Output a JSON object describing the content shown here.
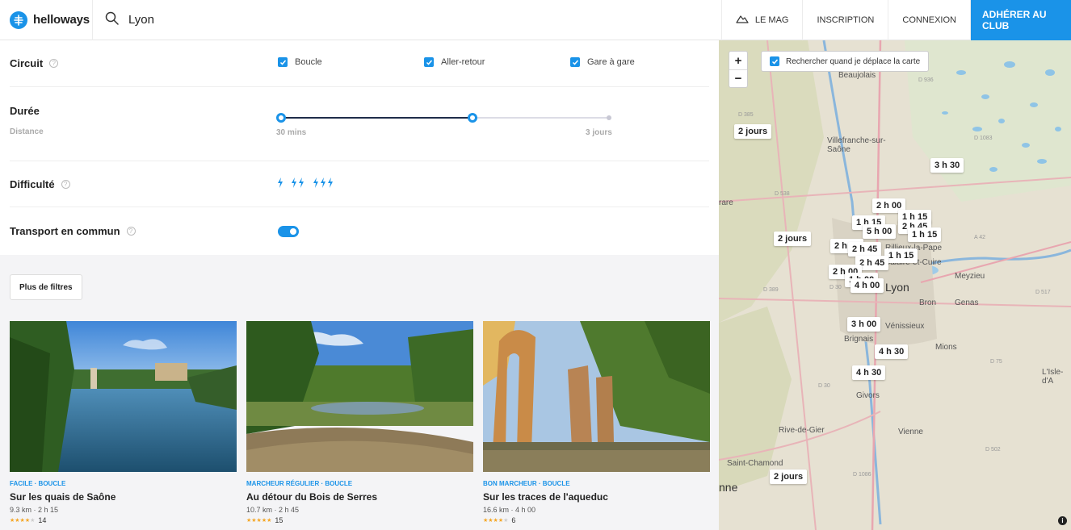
{
  "brand": {
    "name": "helloways",
    "color": "#1a93e8"
  },
  "search": {
    "value": "Lyon",
    "icon": "search-icon"
  },
  "nav": {
    "mag_label": "LE MAG",
    "signup_label": "INSCRIPTION",
    "login_label": "CONNEXION",
    "cta_label": "ADHÉRER AU CLUB"
  },
  "filters": {
    "circuit": {
      "label": "Circuit",
      "options": [
        {
          "label": "Boucle",
          "checked": true
        },
        {
          "label": "Aller-retour",
          "checked": true
        },
        {
          "label": "Gare à gare",
          "checked": true
        }
      ]
    },
    "duree": {
      "label": "Durée",
      "sublabel": "Distance",
      "min_label": "30 mins",
      "max_label": "3 jours",
      "selected_fraction": 0.6
    },
    "difficulte": {
      "label": "Difficulté",
      "levels": [
        "easy",
        "medium",
        "hard"
      ]
    },
    "transport": {
      "label": "Transport en commun",
      "on": true
    }
  },
  "results": {
    "more_filters_label": "Plus de filtres",
    "cards": [
      {
        "tag": "FACILE · BOUCLE",
        "title": "Sur les quais de Saône",
        "meta": "9.3 km · 2 h 15",
        "rating": 4,
        "reviews": "14"
      },
      {
        "tag": "MARCHEUR RÉGULIER · BOUCLE",
        "title": "Au détour du Bois de Serres",
        "meta": "10.7 km · 2 h 45",
        "rating": 5,
        "reviews": "15"
      },
      {
        "tag": "BON MARCHEUR · BOUCLE",
        "title": "Sur les traces de l'aqueduc",
        "meta": "16.6 km · 4 h 00",
        "rating": 4,
        "reviews": "6"
      }
    ]
  },
  "map": {
    "search_on_move_label": "Rechercher quand je déplace la carte",
    "zoom_in": "+",
    "zoom_out": "−",
    "pins": [
      "2 jours",
      "3 h 30",
      "2 h 00",
      "1 h 15",
      "1 h 15",
      "5 h 00",
      "2 h 45",
      "1 h 15",
      "2 jours",
      "2 h 00",
      "2 h 45",
      "1 h 15",
      "2 h 45",
      "2 h 00",
      "1 h 00",
      "4 h 00",
      "3 h 00",
      "4 h 30",
      "4 h 30",
      "2 jours"
    ],
    "places": [
      "Beaujolais",
      "Villefranche-sur-Saône",
      "Rillieux-la-Pape",
      "Caluire-et-Cuire",
      "Lyon",
      "Meyzieu",
      "Bron",
      "Genas",
      "Vénissieux",
      "Mions",
      "Brignais",
      "Givors",
      "Rive-de-Gier",
      "Vienne",
      "Saint-Chamond",
      "L'Isle-d'A",
      "rare",
      "nne"
    ],
    "roads": [
      "D 936",
      "D 385",
      "D 1083",
      "D 538",
      "A 42",
      "D 389",
      "D 30",
      "D 517",
      "D 75",
      "D 502",
      "D 1086",
      "D 30"
    ]
  }
}
